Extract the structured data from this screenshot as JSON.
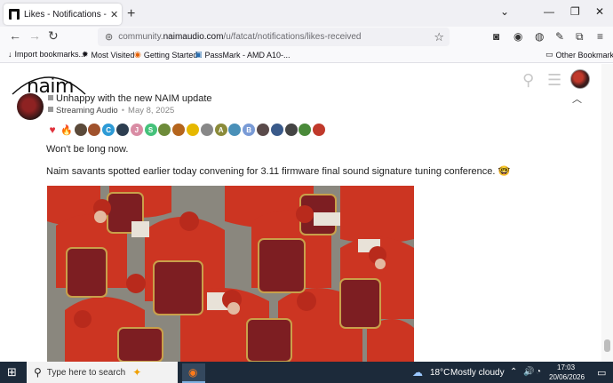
{
  "browser": {
    "tab_title": "Likes - Notifications - Fatcat - N",
    "url_prefix": "community.",
    "url_domain": "naimaudio.com",
    "url_path": "/u/fatcat/notifications/likes-received",
    "bookmarks": [
      {
        "icon": "↓",
        "label": "Import bookmarks..."
      },
      {
        "icon": "✹",
        "label": "Most Visited"
      },
      {
        "icon": "◉",
        "label": "Getting Started"
      },
      {
        "icon": "▣",
        "label": "PassMark - AMD A10-..."
      }
    ],
    "other_bookmarks": "Other Bookmarks"
  },
  "site": {
    "logo_text": "naim"
  },
  "post": {
    "title": "Unhappy with the new NAIM update",
    "category": "Streaming Audio",
    "date": "May 8, 2025",
    "likes": [
      {
        "kind": "heart",
        "color": "#e0303b"
      },
      {
        "kind": "emoji",
        "color": "#ff9a2e"
      },
      {
        "kind": "avatar",
        "color": "#5b4a3a"
      },
      {
        "kind": "avatar",
        "color": "#a0522d"
      },
      {
        "kind": "letter",
        "text": "C",
        "color": "#2e9bd6"
      },
      {
        "kind": "avatar",
        "color": "#2d3e50"
      },
      {
        "kind": "letter",
        "text": "J",
        "color": "#d98ca4"
      },
      {
        "kind": "letter",
        "text": "S",
        "color": "#45c27b"
      },
      {
        "kind": "avatar",
        "color": "#6d8b3a"
      },
      {
        "kind": "avatar",
        "color": "#b5651d"
      },
      {
        "kind": "avatar",
        "color": "#e6b800"
      },
      {
        "kind": "avatar",
        "color": "#888888"
      },
      {
        "kind": "letter",
        "text": "A",
        "color": "#8b8b3a"
      },
      {
        "kind": "avatar",
        "color": "#4a90b8"
      },
      {
        "kind": "letter",
        "text": "B",
        "color": "#7a9bd6"
      },
      {
        "kind": "avatar",
        "color": "#5a4a4a"
      },
      {
        "kind": "avatar",
        "color": "#3a5a8a"
      },
      {
        "kind": "avatar",
        "color": "#444444"
      },
      {
        "kind": "avatar",
        "color": "#4a8a3a"
      },
      {
        "kind": "avatar",
        "color": "#c0392b"
      }
    ],
    "paragraph_1": "Won't be long now.",
    "paragraph_2": "Naim savants spotted earlier today convening for 3.11 firmware final sound signature tuning conference. 🤓"
  },
  "taskbar": {
    "search_placeholder": "Type here to search",
    "weather_temp": "18°C",
    "weather_text": "Mostly cloudy",
    "time": "17:03",
    "date": "20/06/2026"
  },
  "colors": {
    "cardinal_red": "#c8331f",
    "taskbar_bg": "#1c2a3a"
  }
}
